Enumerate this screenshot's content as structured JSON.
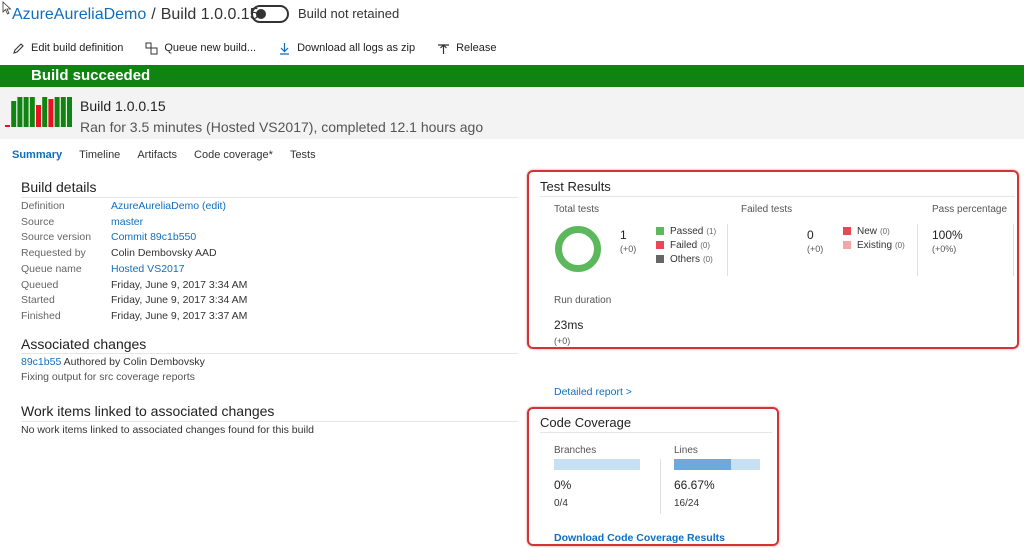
{
  "header": {
    "project": "AzureAureliaDemo",
    "separator": "/",
    "build": "Build 1.0.0.15",
    "retained_label": "Build not retained"
  },
  "toolbar": {
    "edit": "Edit build definition",
    "queue": "Queue new build...",
    "download": "Download all logs as zip",
    "release": "Release"
  },
  "banner": {
    "status": "Build succeeded",
    "color": "#108410"
  },
  "build_summary": {
    "number": "Build 1.0.0.15",
    "ran": "Ran for 3.5 minutes (Hosted VS2017), completed 12.1 hours ago",
    "history_bars": [
      "red",
      "green",
      "green",
      "green",
      "green",
      "red",
      "green",
      "red",
      "green",
      "green",
      "green"
    ]
  },
  "tabs": [
    "Summary",
    "Timeline",
    "Artifacts",
    "Code coverage*",
    "Tests"
  ],
  "build_details": {
    "title": "Build details",
    "rows": [
      {
        "k": "Definition",
        "v": "AzureAureliaDemo (edit)",
        "link": true
      },
      {
        "k": "Source",
        "v": "master",
        "link": true
      },
      {
        "k": "Source version",
        "v": "Commit 89c1b550",
        "link": true
      },
      {
        "k": "Requested by",
        "v": "Colin Dembovsky AAD",
        "link": false
      },
      {
        "k": "Queue name",
        "v": "Hosted VS2017",
        "link": true
      },
      {
        "k": "Queued",
        "v": "Friday, June 9, 2017 3:34 AM",
        "link": false
      },
      {
        "k": "Started",
        "v": "Friday, June 9, 2017 3:34 AM",
        "link": false
      },
      {
        "k": "Finished",
        "v": "Friday, June 9, 2017 3:37 AM",
        "link": false
      }
    ]
  },
  "associated_changes": {
    "title": "Associated changes",
    "commit": "89c1b55",
    "author": "Authored by Colin Dembovsky",
    "message": "Fixing output for src coverage reports"
  },
  "work_items": {
    "title": "Work items linked to associated changes",
    "empty": "No work items linked to associated changes found for this build"
  },
  "test_results": {
    "title": "Test Results",
    "total_label": "Total tests",
    "total": "1",
    "total_delta": "(+0)",
    "legend": [
      {
        "label": "Passed",
        "count": "(1)",
        "color": "#5cb85c"
      },
      {
        "label": "Failed",
        "count": "(0)",
        "color": "#e74856"
      },
      {
        "label": "Others",
        "count": "(0)",
        "color": "#666666"
      }
    ],
    "failed_label": "Failed tests",
    "failed": "0",
    "failed_delta": "(+0)",
    "failed_legend": [
      {
        "label": "New",
        "count": "(0)",
        "color": "#e74856"
      },
      {
        "label": "Existing",
        "count": "(0)",
        "color": "#f4a6a6"
      }
    ],
    "pass_label": "Pass percentage",
    "pass": "100%",
    "pass_delta": "(+0%)",
    "duration_label": "Run duration",
    "duration": "23ms",
    "duration_delta": "(+0)",
    "report_link": "Detailed report >"
  },
  "code_coverage": {
    "title": "Code Coverage",
    "branches_label": "Branches",
    "branches_pct": "0%",
    "branches_ratio": "0/4",
    "branches_fraction": 0,
    "lines_label": "Lines",
    "lines_pct": "66.67%",
    "lines_ratio": "16/24",
    "lines_fraction": 0.6667,
    "download_link": "Download Code Coverage Results"
  }
}
